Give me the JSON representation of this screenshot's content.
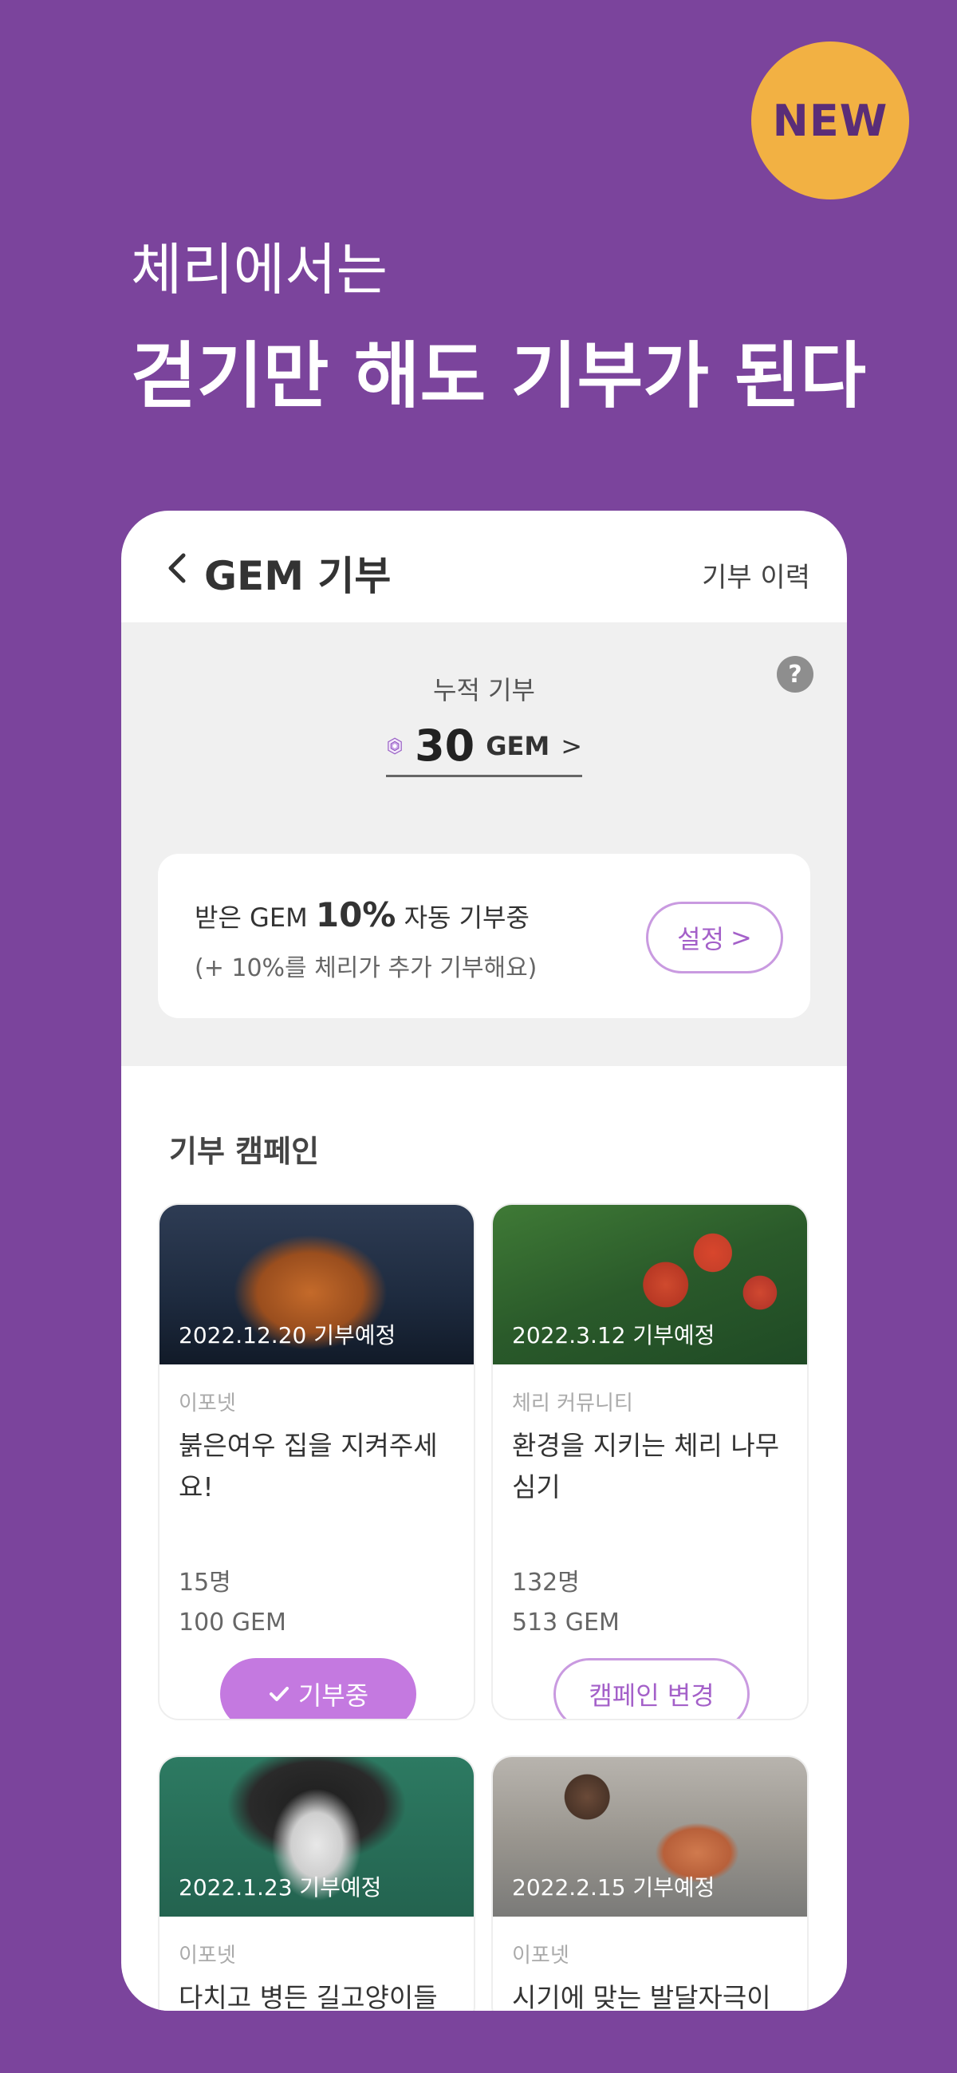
{
  "badge": {
    "label": "NEW"
  },
  "promo": {
    "subtitle": "체리에서는",
    "title": "걷기만 해도 기부가 된다"
  },
  "header": {
    "back_icon": "chevron-left-icon",
    "title": "GEM 기부",
    "history_label": "기부 이력"
  },
  "summary": {
    "help_label": "?",
    "label": "누적 기부",
    "gem_icon": "gem-icon",
    "value": "30",
    "unit": "GEM",
    "arrow": ">"
  },
  "auto_donate": {
    "prefix": "받은 GEM ",
    "percent": "10%",
    "suffix": " 자동 기부중",
    "note": "(+ 10%를 체리가 추가 기부해요)",
    "setting_label": "설정",
    "setting_arrow": ">"
  },
  "campaigns_title": "기부 캠페인",
  "campaigns": [
    {
      "date": "2022.12.20 기부예정",
      "org": "이포넷",
      "title": "붉은여우 집을 지켜주세요!",
      "count": "15명",
      "gem": "100 GEM",
      "button_label": "기부중",
      "button_icon": "check-icon",
      "image": "fox-photo",
      "colors": [
        "#1d2a3e",
        "#3b4a62",
        "#c46a2a"
      ]
    },
    {
      "date": "2022.3.12 기부예정",
      "org": "체리 커뮤니티",
      "title": "환경을 지키는 체리 나무 심기",
      "count": "132명",
      "gem": "513 GEM",
      "button_label": "캠페인 변경",
      "image": "cherry-tomato-photo",
      "colors": [
        "#1f4a25",
        "#3f7a36",
        "#c8402a"
      ]
    },
    {
      "date": "2022.1.23 기부예정",
      "org": "이포넷",
      "title": "다치고 병든 길고양이들의",
      "image": "cat-photo",
      "colors": [
        "#2d7a62",
        "#1e1e1e",
        "#e8e8e8"
      ]
    },
    {
      "date": "2022.2.15 기부예정",
      "org": "이포넷",
      "title": "시기에 맞는 발달자극이 없",
      "image": "child-toys-photo",
      "colors": [
        "#7a7a78",
        "#b8b4ae",
        "#d07a4e"
      ]
    }
  ]
}
